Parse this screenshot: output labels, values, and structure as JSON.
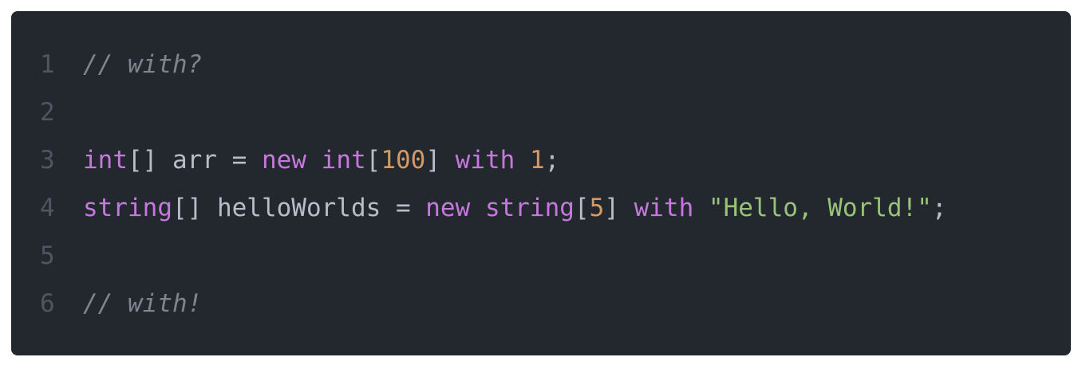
{
  "colors": {
    "background": "#23272e",
    "line_number": "#4f5561",
    "keyword": "#c678dd",
    "plain": "#b8bec9",
    "number": "#d19a66",
    "string": "#98c379",
    "comment": "#7f848e"
  },
  "lines": [
    {
      "number": "1",
      "tokens": [
        {
          "type": "comment",
          "text": "// with?"
        }
      ]
    },
    {
      "number": "2",
      "tokens": []
    },
    {
      "number": "3",
      "tokens": [
        {
          "type": "keyword",
          "text": "int"
        },
        {
          "type": "plain",
          "text": "[] arr = "
        },
        {
          "type": "keyword",
          "text": "new"
        },
        {
          "type": "plain",
          "text": " "
        },
        {
          "type": "keyword",
          "text": "int"
        },
        {
          "type": "plain",
          "text": "["
        },
        {
          "type": "number",
          "text": "100"
        },
        {
          "type": "plain",
          "text": "] "
        },
        {
          "type": "keyword",
          "text": "with"
        },
        {
          "type": "plain",
          "text": " "
        },
        {
          "type": "number",
          "text": "1"
        },
        {
          "type": "plain",
          "text": ";"
        }
      ]
    },
    {
      "number": "4",
      "tokens": [
        {
          "type": "keyword",
          "text": "string"
        },
        {
          "type": "plain",
          "text": "[] helloWorlds = "
        },
        {
          "type": "keyword",
          "text": "new"
        },
        {
          "type": "plain",
          "text": " "
        },
        {
          "type": "keyword",
          "text": "string"
        },
        {
          "type": "plain",
          "text": "["
        },
        {
          "type": "number",
          "text": "5"
        },
        {
          "type": "plain",
          "text": "] "
        },
        {
          "type": "keyword",
          "text": "with"
        },
        {
          "type": "plain",
          "text": " "
        },
        {
          "type": "string",
          "text": "\"Hello, World!\""
        },
        {
          "type": "plain",
          "text": ";"
        }
      ]
    },
    {
      "number": "5",
      "tokens": []
    },
    {
      "number": "6",
      "tokens": [
        {
          "type": "comment",
          "text": "// with!"
        }
      ]
    }
  ]
}
